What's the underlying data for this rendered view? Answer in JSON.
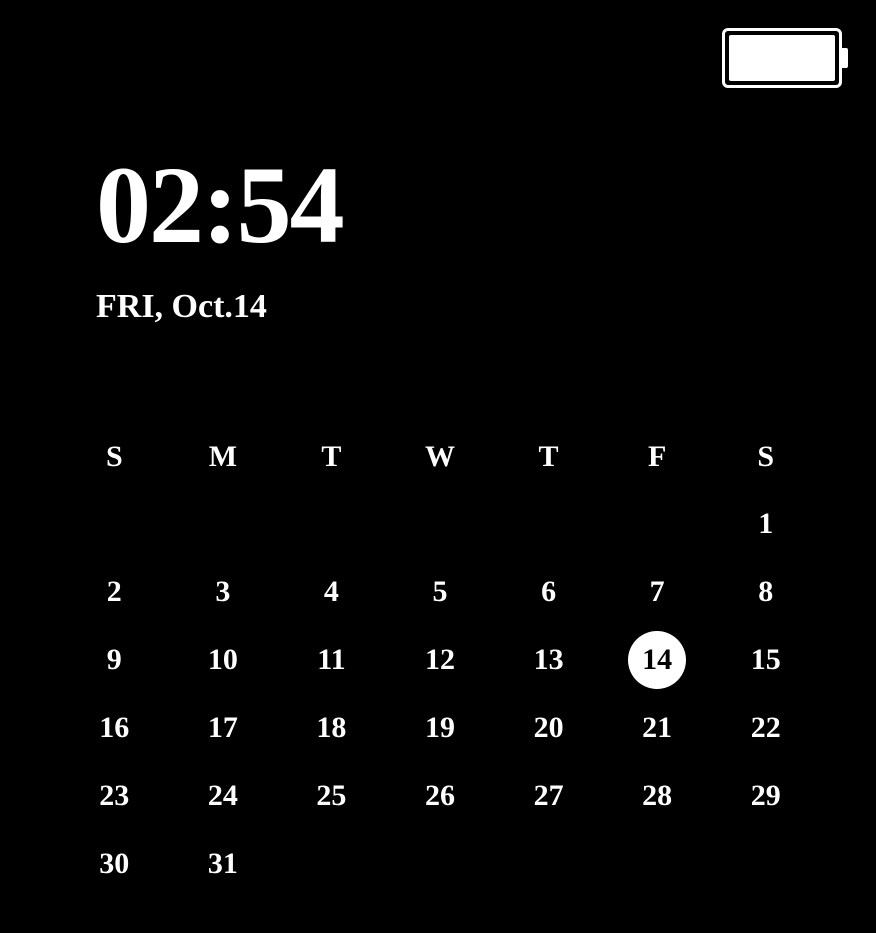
{
  "battery": {
    "level": 100
  },
  "clock": {
    "time": "02:54",
    "date": "FRI, Oct.14"
  },
  "calendar": {
    "weekdays": [
      "S",
      "M",
      "T",
      "W",
      "T",
      "F",
      "S"
    ],
    "current_day": 14,
    "days": [
      [
        "",
        "",
        "",
        "",
        "",
        "",
        "1"
      ],
      [
        "2",
        "3",
        "4",
        "5",
        "6",
        "7",
        "8"
      ],
      [
        "9",
        "10",
        "11",
        "12",
        "13",
        "14",
        "15"
      ],
      [
        "16",
        "17",
        "18",
        "19",
        "20",
        "21",
        "22"
      ],
      [
        "23",
        "24",
        "25",
        "26",
        "27",
        "28",
        "29"
      ],
      [
        "30",
        "31",
        "",
        "",
        "",
        "",
        ""
      ]
    ]
  }
}
